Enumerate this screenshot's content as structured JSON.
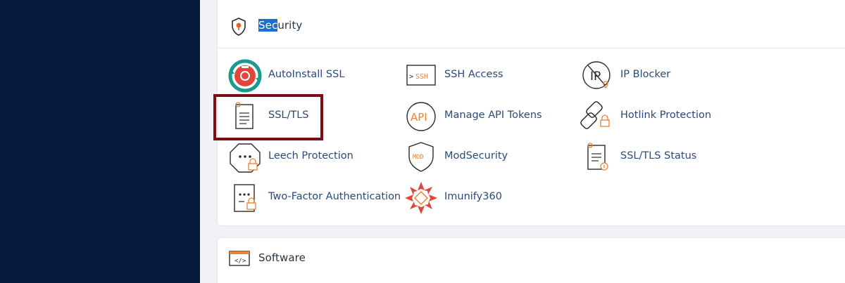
{
  "security": {
    "title_selected": "Sec",
    "title_rest": "urity",
    "items": [
      {
        "label": "AutoInstall SSL",
        "icon": "autoinstall-ssl-icon"
      },
      {
        "label": "SSH Access",
        "icon": "ssh-icon"
      },
      {
        "label": "IP Blocker",
        "icon": "ip-blocker-icon"
      },
      {
        "label": "SSL/TLS",
        "icon": "ssl-tls-icon"
      },
      {
        "label": "Manage API Tokens",
        "icon": "api-icon"
      },
      {
        "label": "Hotlink Protection",
        "icon": "hotlink-icon"
      },
      {
        "label": "Leech Protection",
        "icon": "leech-protection-icon"
      },
      {
        "label": "ModSecurity",
        "icon": "modsecurity-icon"
      },
      {
        "label": "SSL/TLS Status",
        "icon": "ssl-tls-status-icon"
      },
      {
        "label": "Two-Factor Authentication",
        "icon": "two-factor-icon"
      },
      {
        "label": "Imunify360",
        "icon": "imunify360-icon"
      }
    ]
  },
  "software": {
    "title": "Software"
  },
  "colors": {
    "sidebar": "#061a40",
    "link": "#2a4a78",
    "accent_orange": "#e8833a",
    "highlight_border": "#7b0d14",
    "selection": "#1a6fcf"
  }
}
